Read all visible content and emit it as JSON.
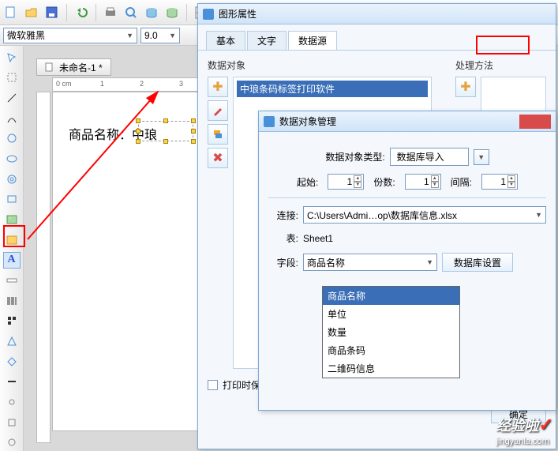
{
  "toolbar_icons": [
    "new",
    "open",
    "save",
    "undo",
    "print",
    "print-preview",
    "zoom",
    "database",
    "grid",
    "settings"
  ],
  "font": {
    "name": "微软雅黑",
    "size": "9.0"
  },
  "left_tools": [
    "pointer",
    "hand",
    "move",
    "line",
    "curve",
    "rect",
    "rounded-rect",
    "ellipse",
    "polygon",
    "image",
    "image2",
    "text",
    "ruler",
    "barcode",
    "qrcode",
    "anchor",
    "triangle",
    "diamond",
    "minus",
    "link",
    "star",
    "cloud",
    "shape1",
    "shape2"
  ],
  "doc": {
    "tab_title": "未命名-1 *",
    "ruler_units": "0 cm",
    "ruler_marks": [
      "0",
      "1",
      "2",
      "3"
    ],
    "canvas_text": "商品名称：中琅"
  },
  "win1": {
    "title": "图形属性",
    "tabs": [
      "基本",
      "文字",
      "数据源"
    ],
    "active_tab": 2,
    "data_object_label": "数据对象",
    "method_label": "处理方法",
    "data_object_value": "中琅条码标签打印软件",
    "side_buttons": [
      "add",
      "edit",
      "layers",
      "delete"
    ],
    "side_buttons2": [
      "add"
    ],
    "print_save": "打印时保存",
    "ok": "确定"
  },
  "win2": {
    "title": "数据对象管理",
    "type_label": "数据对象类型:",
    "type_value": "数据库导入",
    "start_label": "起始:",
    "start_value": "1",
    "count_label": "份数:",
    "count_value": "1",
    "gap_label": "间隔:",
    "gap_value": "1",
    "conn_label": "连接:",
    "conn_value": "C:\\Users\\Admi…op\\数据库信息.xlsx",
    "table_label": "表:",
    "table_value": "Sheet1",
    "field_label": "字段:",
    "field_value": "商品名称",
    "db_settings": "数据库设置",
    "dropdown": [
      "商品名称",
      "单位",
      "数量",
      "商品条码",
      "二维码信息"
    ]
  },
  "watermark": {
    "title": "经验啦",
    "url": "jingyanla.com"
  }
}
